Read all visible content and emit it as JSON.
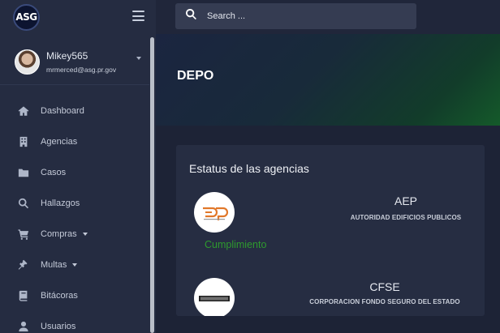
{
  "brand": {
    "logo_text": "ASG"
  },
  "user": {
    "name": "Mikey565",
    "email": "mrmerced@asg.pr.gov"
  },
  "search": {
    "placeholder": "Search ..."
  },
  "menu": [
    {
      "label": "Dashboard",
      "icon": "home-icon",
      "has_caret": false
    },
    {
      "label": "Agencias",
      "icon": "building-icon",
      "has_caret": false
    },
    {
      "label": "Casos",
      "icon": "folder-icon",
      "has_caret": false
    },
    {
      "label": "Hallazgos",
      "icon": "search-icon",
      "has_caret": false
    },
    {
      "label": "Compras",
      "icon": "cart-icon",
      "has_caret": true
    },
    {
      "label": "Multas",
      "icon": "gavel-icon",
      "has_caret": true
    },
    {
      "label": "Bitácoras",
      "icon": "book-icon",
      "has_caret": false
    },
    {
      "label": "Usuarios",
      "icon": "user-icon",
      "has_caret": false
    }
  ],
  "page": {
    "title": "DEPO"
  },
  "card": {
    "title": "Estatus de las agencias",
    "agencies": [
      {
        "code": "AEP",
        "full_name": "AUTORIDAD EDIFICIOS PUBLICOS",
        "status": "Cumplimiento",
        "logo_text": "aep"
      },
      {
        "code": "CFSE",
        "full_name": "CORPORACION FONDO SEGURO DEL ESTADO",
        "status": "",
        "logo_text": ""
      }
    ]
  },
  "colors": {
    "status_ok": "#2e9a2e",
    "sidebar_bg": "#252c41",
    "accent": "#e1782a"
  }
}
